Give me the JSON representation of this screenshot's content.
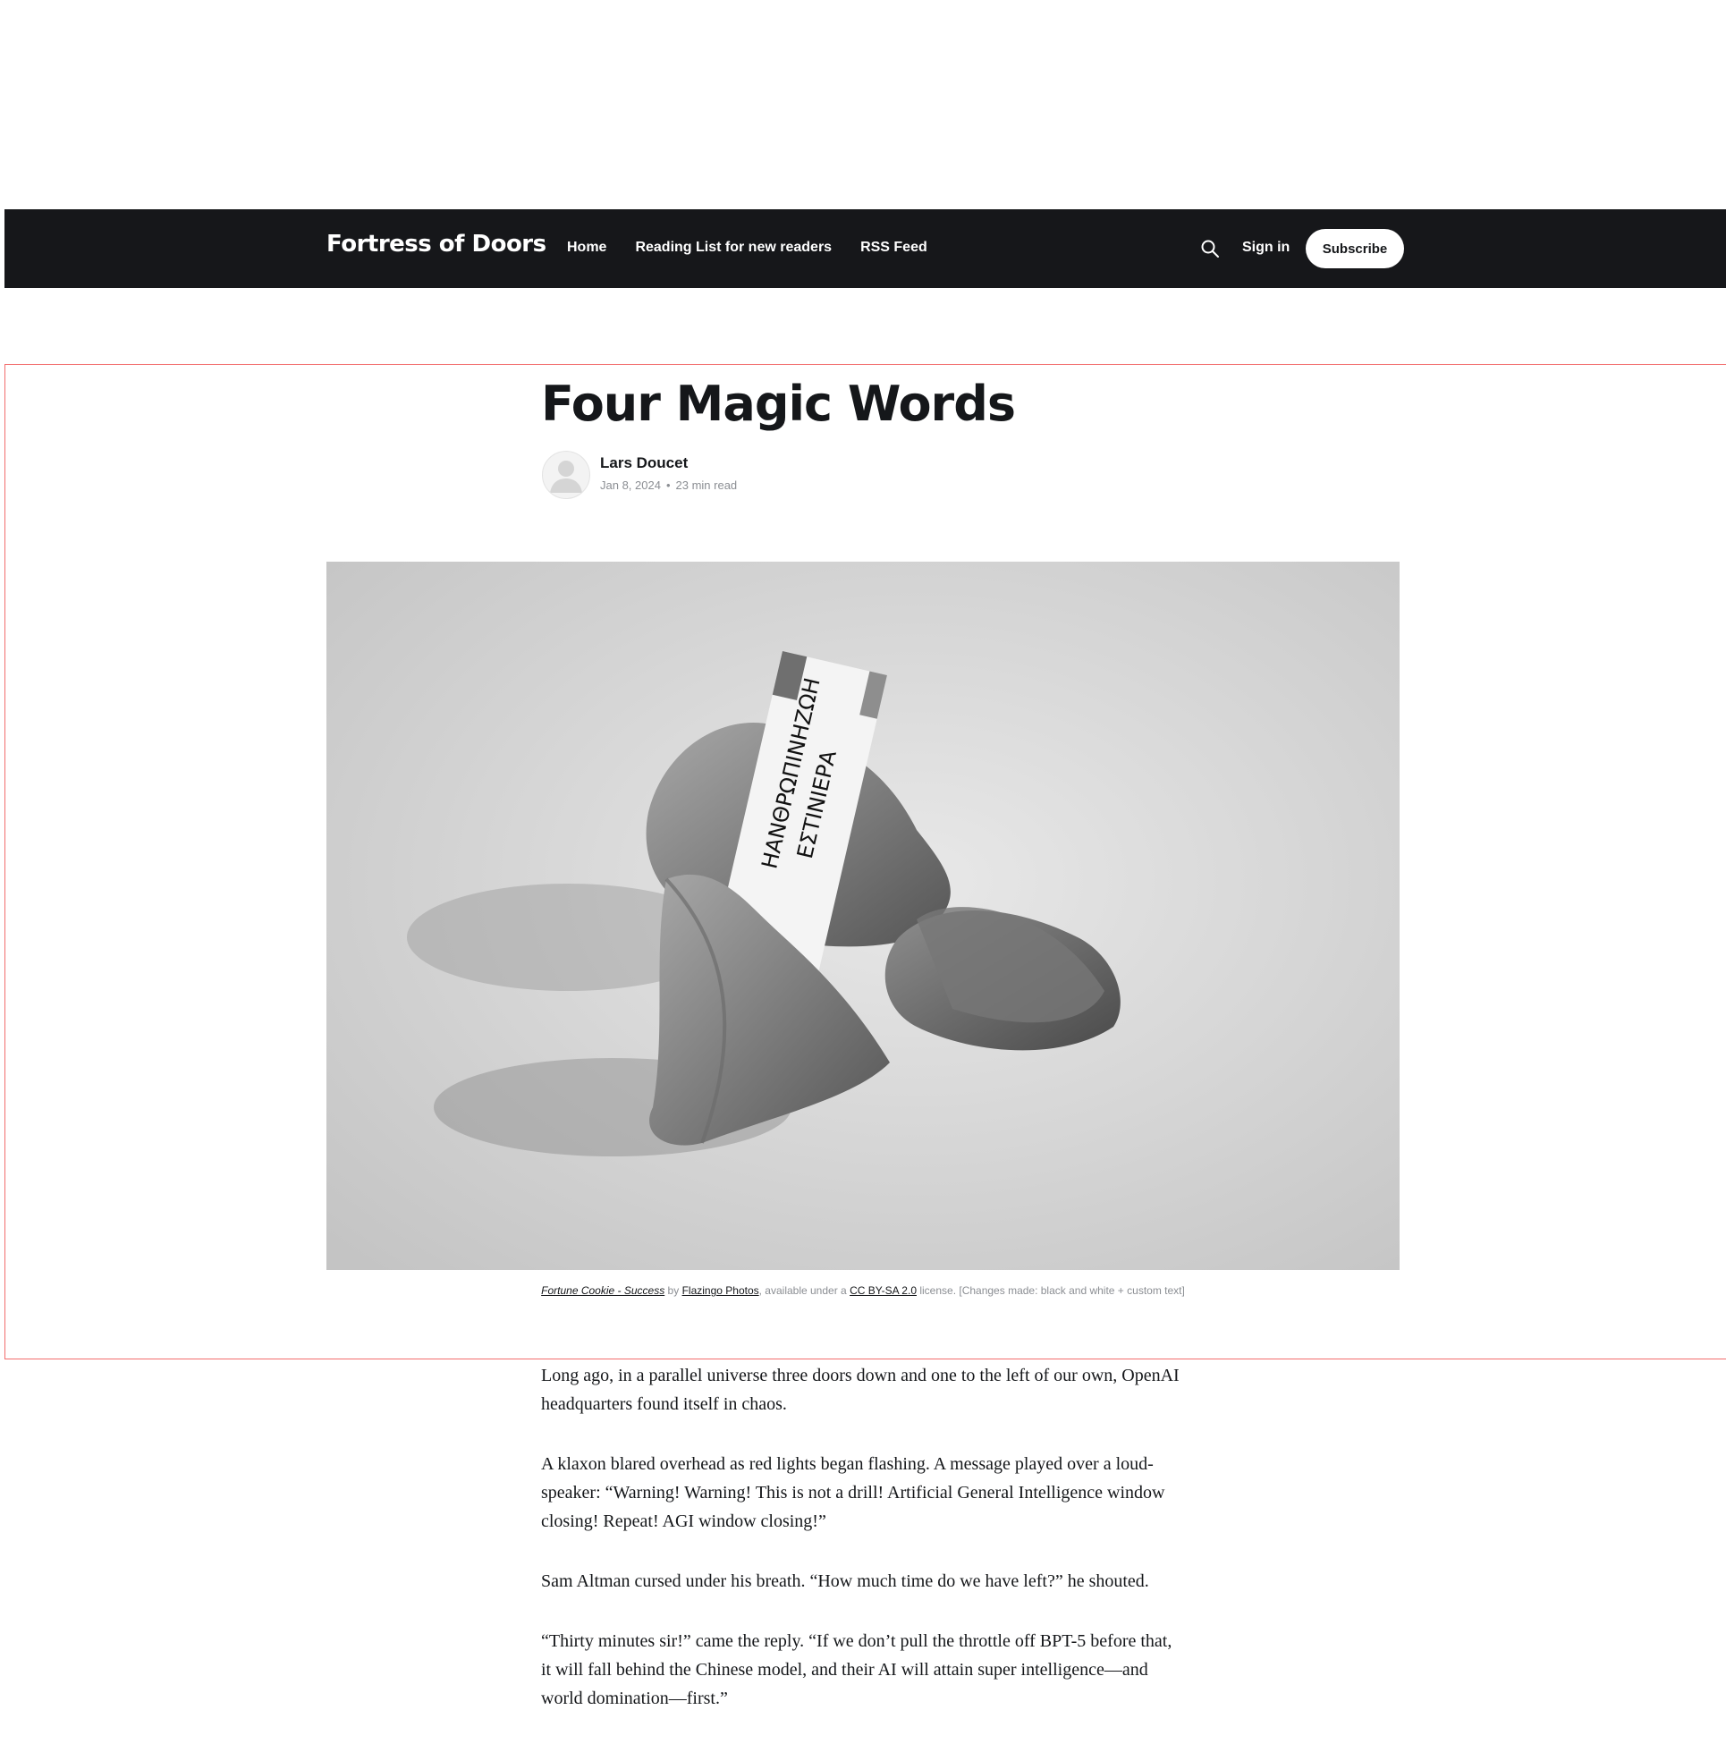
{
  "nav": {
    "brand": "Fortress of Doors",
    "links": [
      "Home",
      "Reading List for new readers",
      "RSS Feed"
    ],
    "signin_label": "Sign in",
    "subscribe_label": "Subscribe"
  },
  "article": {
    "title": "Four Magic Words",
    "author": "Lars Doucet",
    "date": "Jan 8, 2024",
    "read_time": "23 min read",
    "image_slip_text": [
      "ΗΑΝΘΡΩΠΙΝΗΖΩΗ",
      "ΕΣΤΙΝΙΕΡΑ"
    ],
    "caption": {
      "work": "Fortune Cookie - Success",
      "by": "by",
      "author_link": "Flazingo Photos",
      "available": ", available under a",
      "license_link": "CC BY-SA 2.0",
      "tail": "license. [Changes made: black and white + custom text]"
    },
    "paragraphs": [
      "Long ago, in a parallel universe three doors down and one to the left of our own, OpenAI headquarters found itself in chaos.",
      "A klaxon blared overhead as red lights began flashing. A message played over a loud-speaker: “Warning! Warning! This is not a drill! Artificial General Intelligence window closing! Repeat! AGI window closing!”",
      "Sam Altman cursed under his breath. “How much time do we have left?” he shouted.",
      "“Thirty minutes sir!” came the reply. “If we don’t pull the throttle off BPT-5 before that, it will fall behind the Chinese model, and their AI will attain super intelligence—and world domination—first.”"
    ]
  },
  "colors": {
    "navbar_bg": "#16171a",
    "highlight_frame": "#f26d6d",
    "meta_text": "#8b8e93"
  }
}
